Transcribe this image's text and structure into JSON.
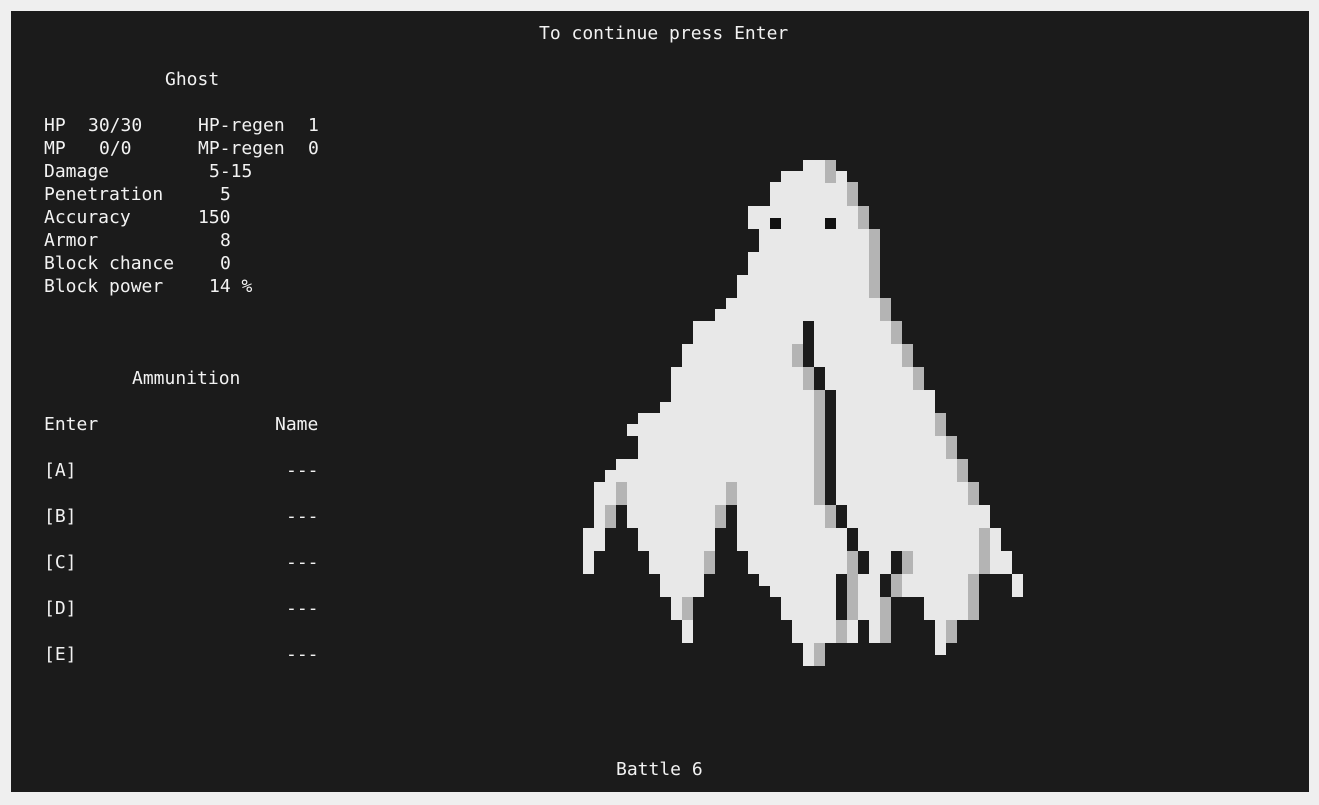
{
  "header": {
    "prompt": "To continue press Enter"
  },
  "enemy": {
    "name": "Ghost",
    "stats": {
      "hp_label": "HP",
      "hp_value": "30/30",
      "hp_regen_label": "HP-regen",
      "hp_regen_value": "1",
      "mp_label": "MP",
      "mp_value": "0/0",
      "mp_regen_label": "MP-regen",
      "mp_regen_value": "0",
      "damage_label": "Damage",
      "damage_value": "5-15",
      "penetration_label": "Penetration",
      "penetration_value": "5",
      "accuracy_label": "Accuracy",
      "accuracy_value": "150",
      "armor_label": "Armor",
      "armor_value": "8",
      "block_chance_label": "Block chance",
      "block_chance_value": "0",
      "block_power_label": "Block power",
      "block_power_value": "14 %"
    }
  },
  "ammunition": {
    "title": "Ammunition",
    "col_enter": "Enter",
    "col_name": "Name",
    "slots": [
      {
        "key": "[A]",
        "name": "---"
      },
      {
        "key": "[B]",
        "name": "---"
      },
      {
        "key": "[C]",
        "name": "---"
      },
      {
        "key": "[D]",
        "name": "---"
      },
      {
        "key": "[E]",
        "name": "---"
      }
    ]
  },
  "footer": {
    "battle_label": "Battle 6"
  },
  "colors": {
    "background": "#1b1b1b",
    "text": "#f2f2f2",
    "ghost_light": "#e8e8e8",
    "ghost_shade": "#b4b4b4",
    "ghost_eye": "#111111"
  },
  "sprite_name": "ghost-sprite"
}
